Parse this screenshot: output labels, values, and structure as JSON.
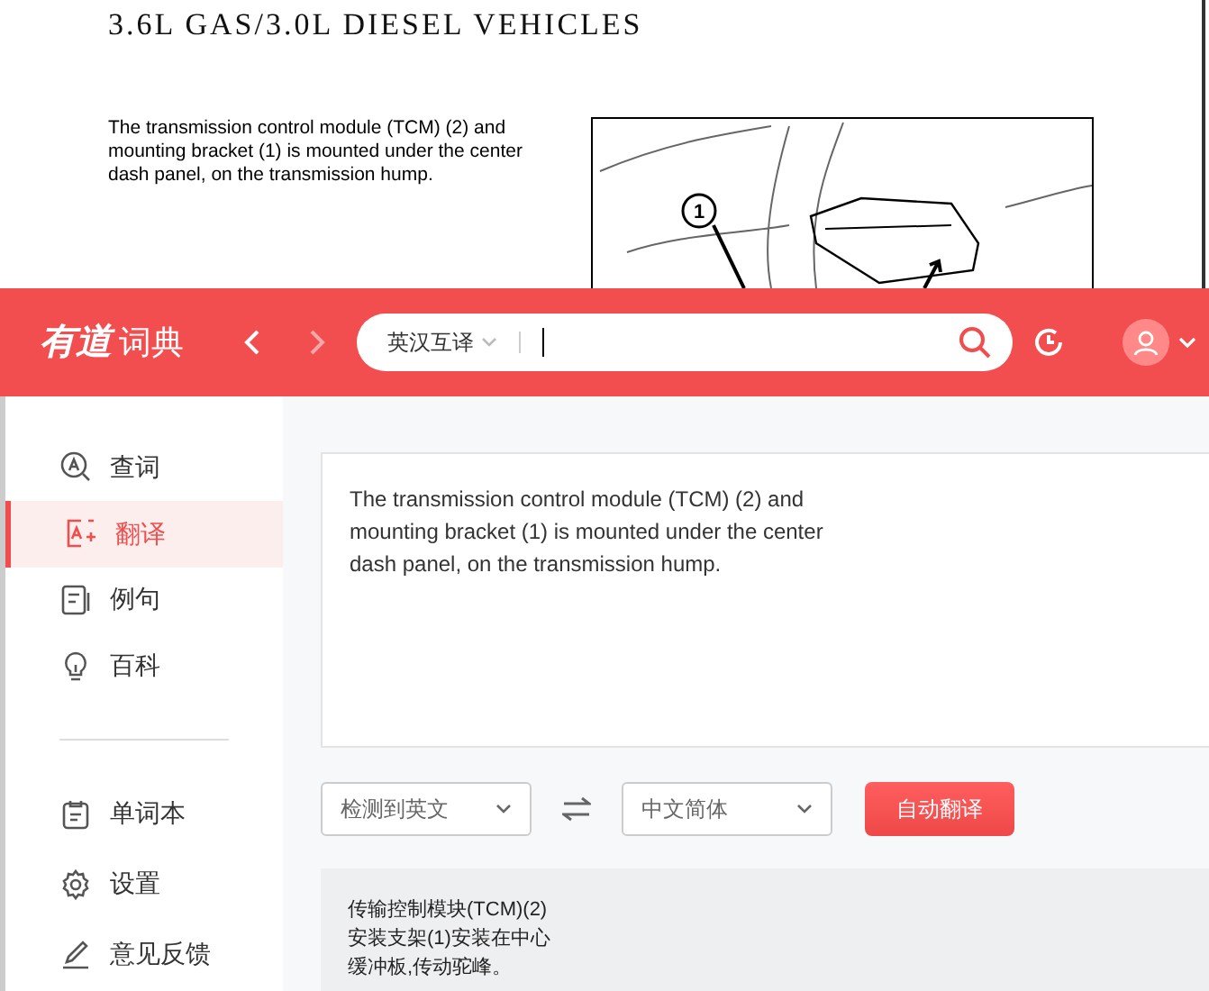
{
  "document": {
    "title": "3.6L GAS/3.0L DIESEL VEHICLES",
    "paragraph": "The transmission control module (TCM) (2) and mounting bracket (1) is mounted under the center dash panel, on the transmission hump.",
    "callout": "1"
  },
  "app": {
    "logo": {
      "mark": "有道",
      "name": "词典"
    },
    "nav": {
      "back_disabled": false,
      "forward_disabled": true
    },
    "search": {
      "mode": "英汉互译"
    },
    "sidebar": {
      "items": [
        {
          "label": "查词",
          "selected": false
        },
        {
          "label": "翻译",
          "selected": true
        },
        {
          "label": "例句",
          "selected": false
        },
        {
          "label": "百科",
          "selected": false
        }
      ],
      "tools": [
        {
          "label": "单词本"
        },
        {
          "label": "设置"
        },
        {
          "label": "意见反馈"
        }
      ]
    },
    "translate": {
      "source_text": "The transmission control module (TCM) (2) and\nmounting bracket (1) is mounted under the center\ndash panel, on the transmission hump.",
      "source_lang": "检测到英文",
      "target_lang": "中文简体",
      "button": "自动翻译",
      "result_lines": [
        "传输控制模块(TCM)(2)",
        "安装支架(1)安装在中心",
        "缓冲板,传动驼峰。"
      ]
    }
  }
}
